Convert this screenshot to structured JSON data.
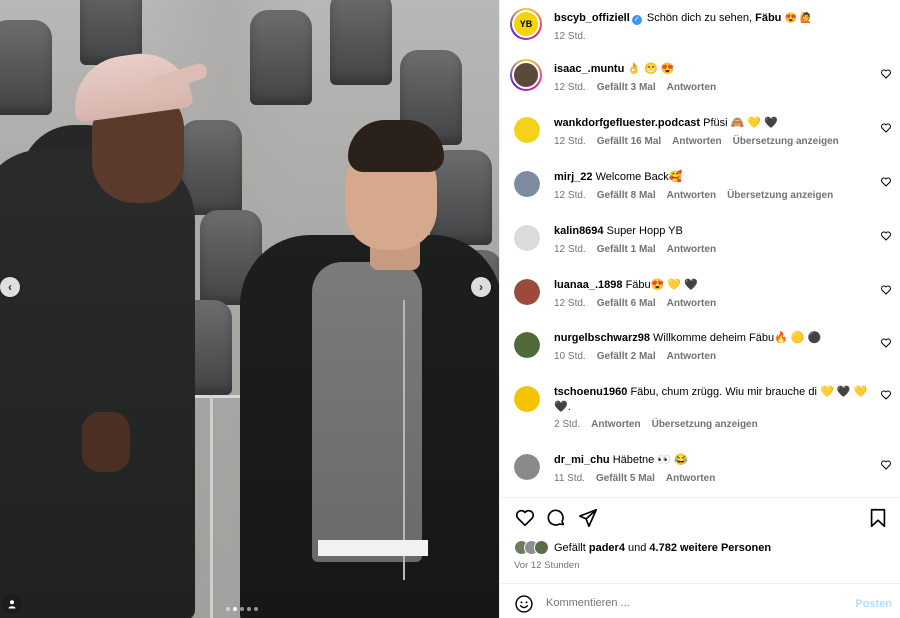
{
  "post": {
    "carousel_dots": 5,
    "active_dot": 1,
    "nav_prev": "‹",
    "nav_next": "›"
  },
  "caption": {
    "username": "bscyb_offiziell",
    "text": "Schön dich zu sehen,",
    "mention": "Fäbu",
    "emojis": "😍 🙋",
    "time": "12 Std."
  },
  "comments": [
    {
      "username": "isaac_.muntu",
      "text": "👌 😁 😍",
      "time": "12 Std.",
      "likes": "Gefällt 3 Mal",
      "reply": "Antworten",
      "translate": "",
      "avatar_color": "#5b4a3c",
      "avatar_ring": true
    },
    {
      "username": "wankdorfgefluester.podcast",
      "text": "Pfüsi 🙈 💛 🖤",
      "time": "12 Std.",
      "likes": "Gefällt 16 Mal",
      "reply": "Antworten",
      "translate": "Übersetzung anzeigen",
      "avatar_color": "#f5d21a",
      "avatar_ring": false
    },
    {
      "username": "mirj_22",
      "text": "Welcome Back🥰",
      "time": "12 Std.",
      "likes": "Gefällt 8 Mal",
      "reply": "Antworten",
      "translate": "Übersetzung anzeigen",
      "avatar_color": "#7d8aa0",
      "avatar_ring": false
    },
    {
      "username": "kalin8694",
      "text": "Super Hopp YB",
      "time": "12 Std.",
      "likes": "Gefällt 1 Mal",
      "reply": "Antworten",
      "translate": "",
      "avatar_color": "#dbdbdb",
      "avatar_ring": false
    },
    {
      "username": "luanaa_.1898",
      "text": "Fäbu😍 💛 🖤",
      "time": "12 Std.",
      "likes": "Gefällt 6 Mal",
      "reply": "Antworten",
      "translate": "",
      "avatar_color": "#9c4a3a",
      "avatar_ring": false
    },
    {
      "username": "nurgelbschwarz98",
      "text": "Willkomme deheim Fäbu🔥 🟡 ⚫",
      "time": "10 Std.",
      "likes": "Gefällt 2 Mal",
      "reply": "Antworten",
      "translate": "",
      "avatar_color": "#4f6b3a",
      "avatar_ring": false
    },
    {
      "username": "tschoenu1960",
      "text": "Fäbu, chum zrügg. Wiu mir brauche di 💛 🖤 💛 🖤.",
      "time": "2 Std.",
      "likes": "",
      "reply": "Antworten",
      "translate": "Übersetzung anzeigen",
      "avatar_color": "#f5c400",
      "avatar_ring": false
    },
    {
      "username": "dr_mi_chu",
      "text": "Häbetne 👀 😂",
      "time": "11 Std.",
      "likes": "Gefällt 5 Mal",
      "reply": "Antworten",
      "translate": "",
      "avatar_color": "#8a8a8a",
      "avatar_ring": false
    }
  ],
  "likes_summary": {
    "prefix": "Gefällt",
    "user": "pader4",
    "middle": "und",
    "count": "4.782 weitere Personen"
  },
  "posted_ago": "Vor 12 Stunden",
  "composer": {
    "placeholder": "Kommentieren ...",
    "post_label": "Posten"
  },
  "icons": {
    "like": "heart-icon",
    "comment": "comment-icon",
    "share": "share-icon",
    "save": "bookmark-icon",
    "emoji": "smiley-icon",
    "tag": "user-tag-icon"
  },
  "colors": {
    "meta_gray": "#737373",
    "post_button": "#b2dffc",
    "verified": "#3897f0"
  }
}
